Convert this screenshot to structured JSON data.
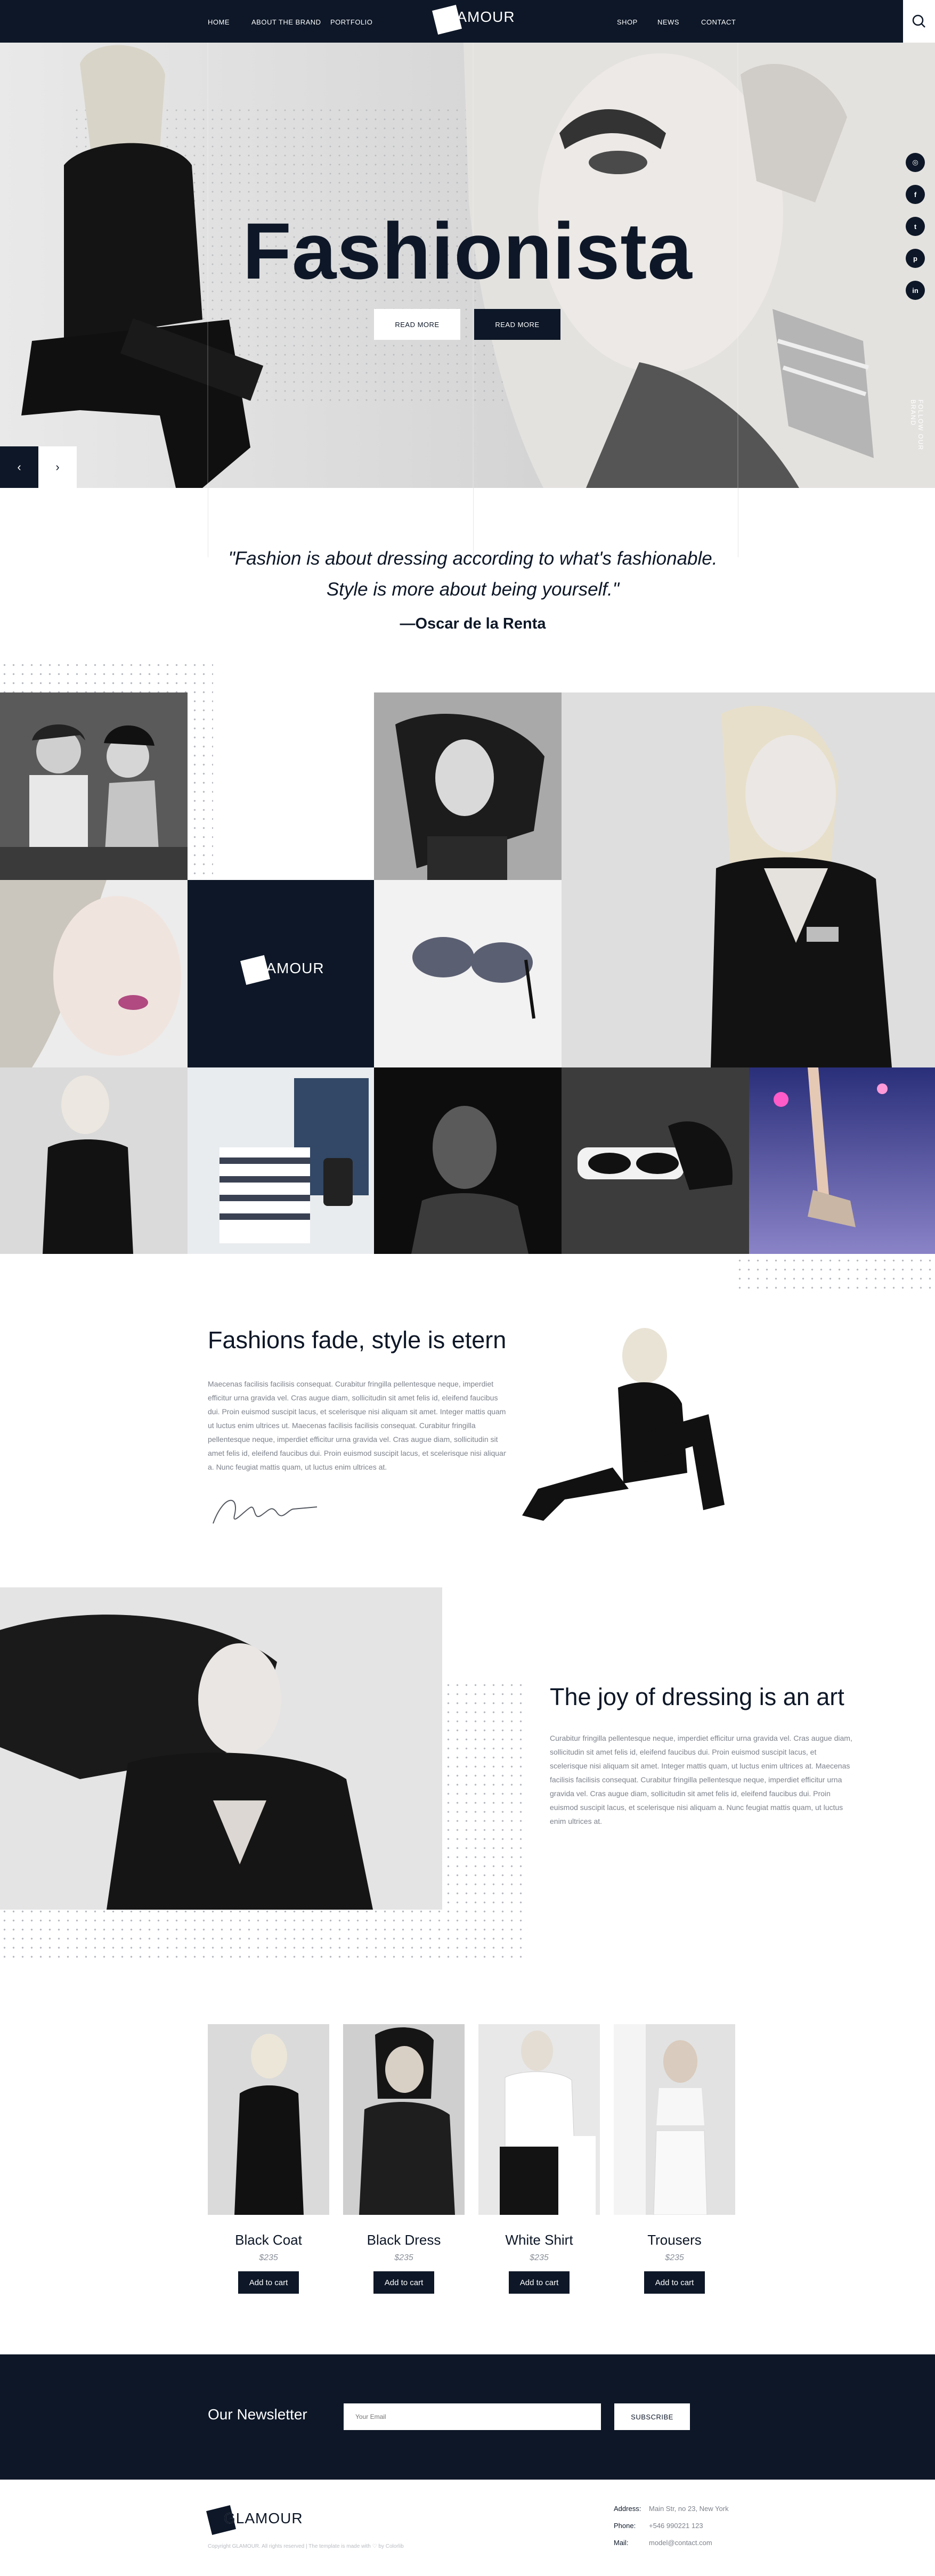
{
  "header": {
    "nav_left": [
      "HOME",
      "ABOUT THE BRAND",
      "PORTFOLIO"
    ],
    "nav_right": [
      "SHOP",
      "NEWS",
      "CONTACT"
    ],
    "logo_text": "GLAMOUR"
  },
  "hero": {
    "title": "Fashionista",
    "button_primary": "READ MORE",
    "button_secondary": "READ MORE",
    "follow_label": "FOLLOW OUR BRAND",
    "social_icons": [
      "instagram-icon",
      "facebook-icon",
      "twitter-icon",
      "pinterest-icon",
      "linkedin-icon"
    ],
    "social_glyphs": [
      "◎",
      "f",
      "t",
      "p",
      "in"
    ],
    "prev_arrow": "‹",
    "next_arrow": "›"
  },
  "quote": {
    "text": "\"Fashion is about dressing according to what's fashionable. Style is more about being yourself.\"",
    "author": "—Oscar de la Renta"
  },
  "gallery": {
    "logo_text": "GLAMOUR"
  },
  "about": {
    "title": "Fashions fade, style is eternal",
    "body": "Maecenas facilisis facilisis consequat. Curabitur fringilla pellentesque neque, imperdiet efficitur urna gravida vel. Cras augue diam, sollicitudin sit amet felis id, eleifend faucibus dui. Proin euismod suscipit lacus, et scelerisque nisi aliquam sit amet. Integer mattis quam, ut luctus enim ultrices ut. Maecenas facilisis facilisis consequat. Curabitur fringilla pellentesque neque, imperdiet efficitur urna gravida vel. Cras augue diam, sollicitudin sit amet felis id, eleifend faucibus dui. Proin euismod suscipit lacus, et scelerisque nisi aliquam a. Nunc feugiat mattis quam, ut luctus enim ultrices at."
  },
  "joy": {
    "title": "The joy of dressing is an art",
    "body": "Curabitur fringilla pellentesque neque, imperdiet efficitur urna gravida vel. Cras augue diam, sollicitudin sit amet felis id, eleifend faucibus dui. Proin euismod suscipit lacus, et scelerisque nisi aliquam sit amet. Integer mattis quam, ut luctus enim ultrices at. Maecenas facilisis facilisis consequat. Curabitur fringilla pellentesque neque, imperdiet efficitur urna gravida vel. Cras augue diam, sollicitudin sit amet felis id, eleifend faucibus dui. Proin euismod suscipit lacus, et scelerisque nisi aliquam a. Nunc feugiat mattis quam, ut luctus enim ultrices at."
  },
  "products": [
    {
      "name": "Black Coat",
      "price": "$235",
      "button": "Add to cart"
    },
    {
      "name": "Black Dress",
      "price": "$235",
      "button": "Add to cart"
    },
    {
      "name": "White Shirt",
      "price": "$235",
      "button": "Add to cart"
    },
    {
      "name": "Trousers",
      "price": "$235",
      "button": "Add to cart"
    }
  ],
  "newsletter": {
    "title": "Our Newsletter",
    "placeholder": "Your Email",
    "button": "SUBSCRIBE"
  },
  "footer": {
    "logo_text": "GLAMOUR",
    "copyright": "Copyright GLAMOUR. All rights reserved | The template is made with ♡ by Colorlib",
    "contact": [
      {
        "label": "Address:",
        "value": "Main Str, no 23, New York"
      },
      {
        "label": "Phone:",
        "value": "+546 990221 123"
      },
      {
        "label": "Mail:",
        "value": "model@contact.com"
      }
    ]
  },
  "colors": {
    "navy": "#0d1727",
    "white": "#ffffff",
    "muted": "#7d828b"
  }
}
